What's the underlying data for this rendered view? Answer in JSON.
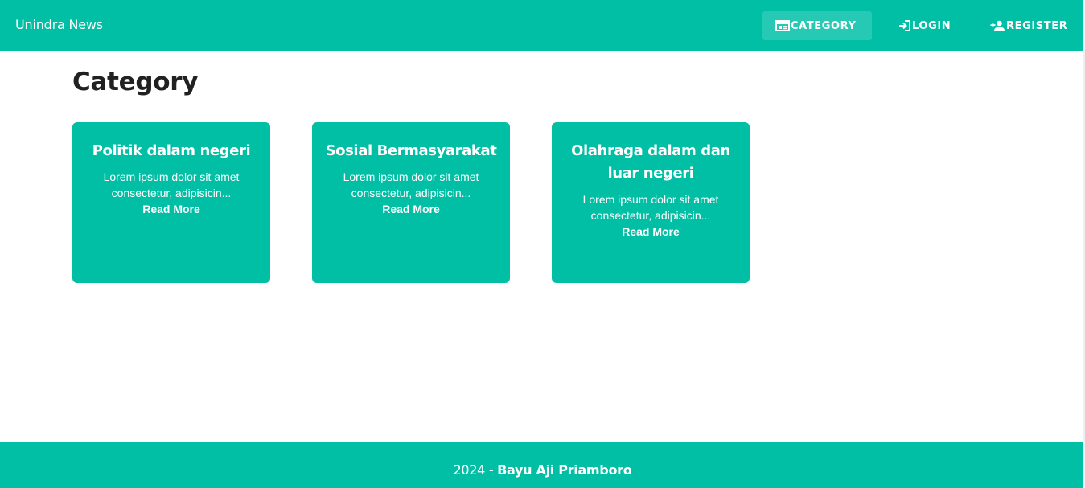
{
  "navbar": {
    "brand": "Unindra News",
    "items": [
      {
        "label": "CATEGORY",
        "icon": "category-icon",
        "active": true
      },
      {
        "label": "LOGIN",
        "icon": "login-icon",
        "active": false
      },
      {
        "label": "REGISTER",
        "icon": "person-add-icon",
        "active": false
      }
    ]
  },
  "page": {
    "title": "Category"
  },
  "cards": [
    {
      "title": "Politik dalam negeri",
      "text": "Lorem ipsum dolor sit amet consectetur, adipisicin...",
      "link": "Read More"
    },
    {
      "title": "Sosial Bermasyarakat",
      "text": "Lorem ipsum dolor sit amet consectetur, adipisicin...",
      "link": "Read More"
    },
    {
      "title": "Olahraga dalam dan luar negeri",
      "text": "Lorem ipsum dolor sit amet consectetur, adipisicin...",
      "link": "Read More"
    }
  ],
  "footer": {
    "year": "2024 - ",
    "author": "Bayu Aji Priamboro"
  },
  "colors": {
    "primary": "#00bfa5",
    "active_nav": "#26c9b3",
    "title_text": "#212121"
  }
}
